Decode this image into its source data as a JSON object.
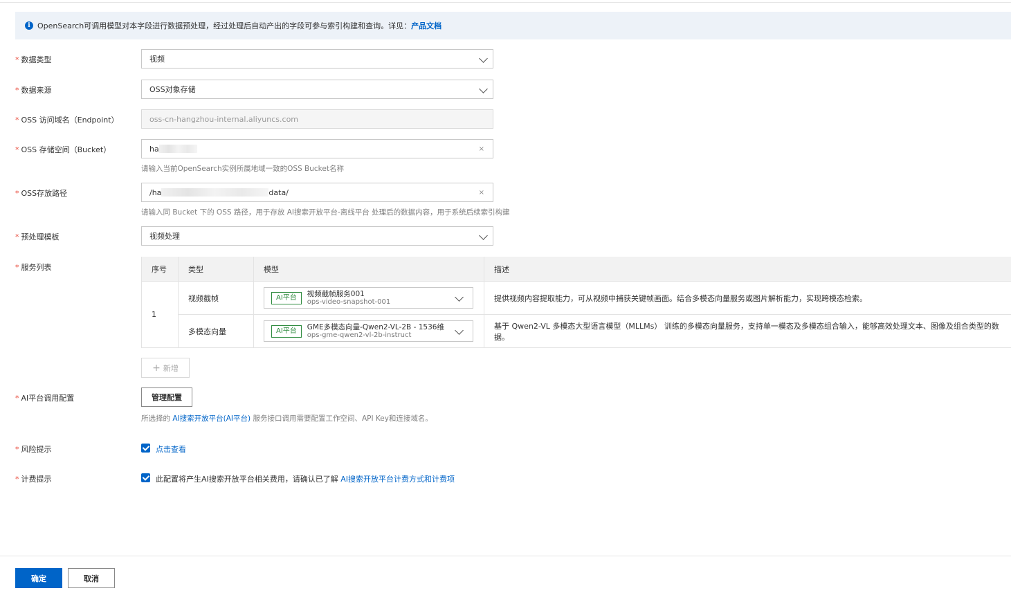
{
  "notice": {
    "text": "OpenSearch可调用模型对本字段进行数据预处理，经过处理后自动产出的字段可参与索引构建和查询。详见：",
    "link": "产品文档"
  },
  "form": {
    "data_type": {
      "label": "数据类型",
      "value": "视频"
    },
    "data_source": {
      "label": "数据来源",
      "value": "OSS对象存储"
    },
    "endpoint": {
      "label": "OSS 访问域名（Endpoint）",
      "value": "oss-cn-hangzhou-internal.aliyuncs.com"
    },
    "bucket": {
      "label": "OSS 存储空间（Bucket）",
      "value": "ha",
      "clear": "×",
      "hint": "请输入当前OpenSearch实例所属地域一致的OSS Bucket名称"
    },
    "path": {
      "label": "OSS存放路径",
      "value_start": "/ha",
      "value_end": "data/",
      "clear": "×",
      "hint": "请输入同 Bucket 下的 OSS 路径，用于存放 AI搜索开放平台-离线平台 处理后的数据内容，用于系统后续索引构建"
    },
    "template": {
      "label": "预处理模板",
      "value": "视频处理"
    },
    "service_list": {
      "label": "服务列表"
    },
    "ai_config": {
      "label": "AI平台调用配置",
      "button": "管理配置",
      "hint_prefix": "所选择的 ",
      "hint_link": "AI搜索开放平台(AI平台)",
      "hint_suffix": " 服务接口调用需要配置工作空间、API Key和连接域名。"
    },
    "risk": {
      "label": "风险提示",
      "link": "点击查看"
    },
    "billing": {
      "label": "计费提示",
      "text": "此配置将产生AI搜索开放平台相关费用，请确认已了解 ",
      "link": "AI搜索开放平台计费方式和计费项"
    }
  },
  "table": {
    "headers": [
      "序号",
      "类型",
      "模型",
      "描述"
    ],
    "index": "1",
    "rows": [
      {
        "type": "视频截帧",
        "tag": "AI平台",
        "model_name": "视频截帧服务001",
        "model_id": "ops-video-snapshot-001",
        "desc": "提供视频内容提取能力，可从视频中捕获关键帧画面。结合多模态向量服务或图片解析能力，实现跨模态检索。"
      },
      {
        "type": "多模态向量",
        "tag": "AI平台",
        "model_name": "GME多模态向量-Qwen2-VL-2B - 1536维",
        "model_id": "ops-gme-qwen2-vl-2b-instruct",
        "desc": "基于 Qwen2-VL 多模态大型语言模型（MLLMs） 训练的多模态向量服务，支持单一模态及多模态组合输入，能够高效处理文本、图像及组合类型的数据。"
      }
    ],
    "add_button": "新增"
  },
  "footer": {
    "ok": "确定",
    "cancel": "取消"
  }
}
